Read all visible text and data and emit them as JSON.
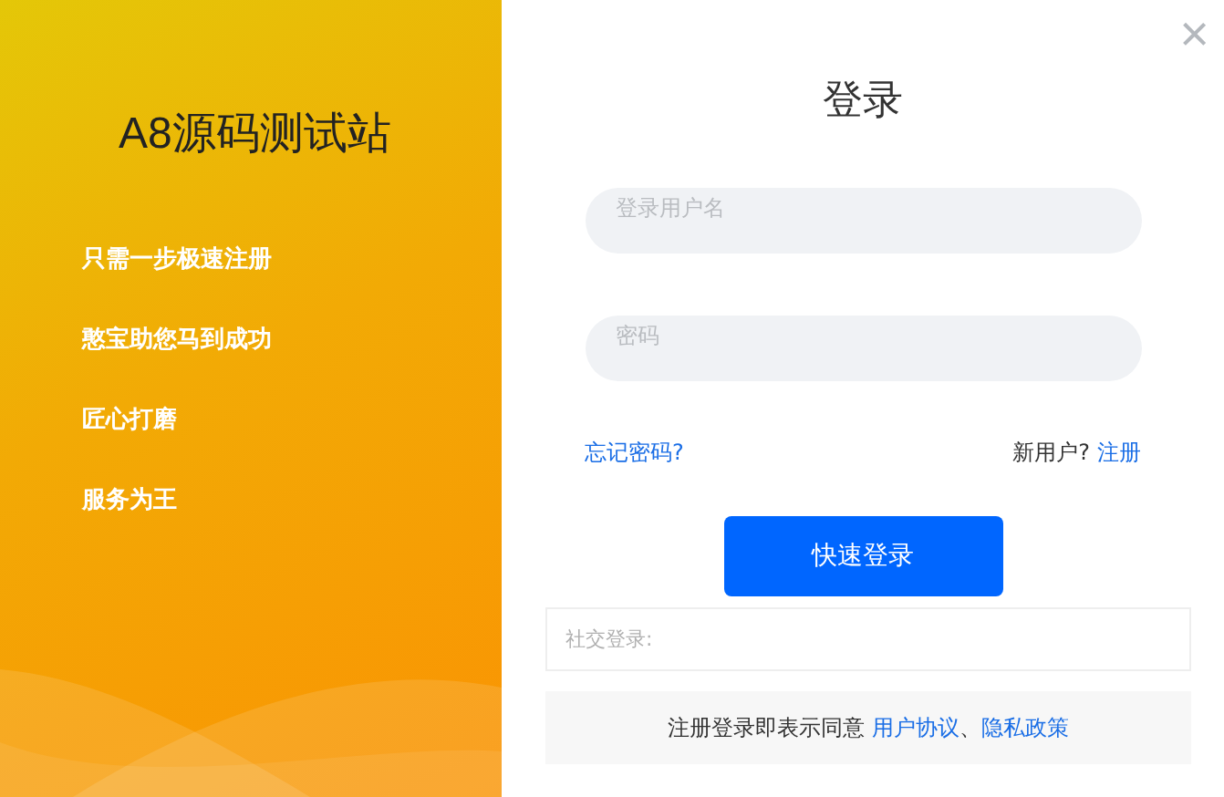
{
  "brand": {
    "title": "A8源码测试站",
    "features": [
      "只需一步极速注册",
      "憨宝助您马到成功",
      "匠心打磨",
      "服务为王"
    ]
  },
  "login": {
    "title": "登录",
    "close": "×",
    "fields": [
      {
        "placeholder": "登录用户名"
      },
      {
        "placeholder": "密码"
      }
    ],
    "forgot": "忘记密码?",
    "new_user": "新用户?",
    "register": "注册",
    "submit": "快速登录",
    "social_label": "社交登录:",
    "agreement": {
      "prefix": "注册登录即表示同意",
      "links": [
        "用户协议",
        "隐私政策"
      ],
      "separator": "、"
    }
  }
}
